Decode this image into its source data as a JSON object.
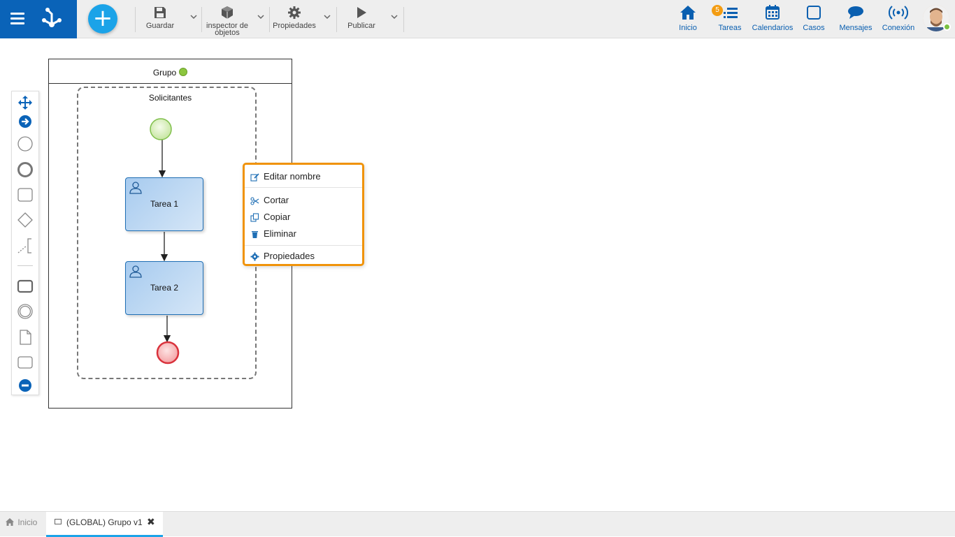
{
  "toolbar": {
    "save_label": "Guardar",
    "inspector_label_1": "inspector de",
    "inspector_label_2": "objetos",
    "properties_label": "Propiedades",
    "publish_label": "Publicar",
    "add_symbol": "+"
  },
  "nav": {
    "home": "Inicio",
    "tasks": "Tareas",
    "tasks_badge": "5",
    "calendars": "Calendarios",
    "cases": "Casos",
    "messages": "Mensajes",
    "connection": "Conexión"
  },
  "diagram": {
    "pool_name": "Grupo",
    "lane_name": "Solicitantes",
    "tasks": [
      "Tarea 1",
      "Tarea 2"
    ]
  },
  "context_menu": {
    "items": [
      "Editar nombre",
      "Cortar",
      "Copiar",
      "Eliminar",
      "Propiedades"
    ]
  },
  "bottom_tabs": {
    "home": "Inicio",
    "active_tab": "(GLOBAL) Grupo v1",
    "close_symbol": "✖"
  },
  "colors": {
    "brand": "#0a63b8",
    "accent": "#1ba3e8",
    "menu_border": "#f0930a",
    "task_border": "#1f6fb5",
    "start_event": "#8cc63f",
    "end_event": "#d9323c",
    "badge": "#f39c12"
  }
}
